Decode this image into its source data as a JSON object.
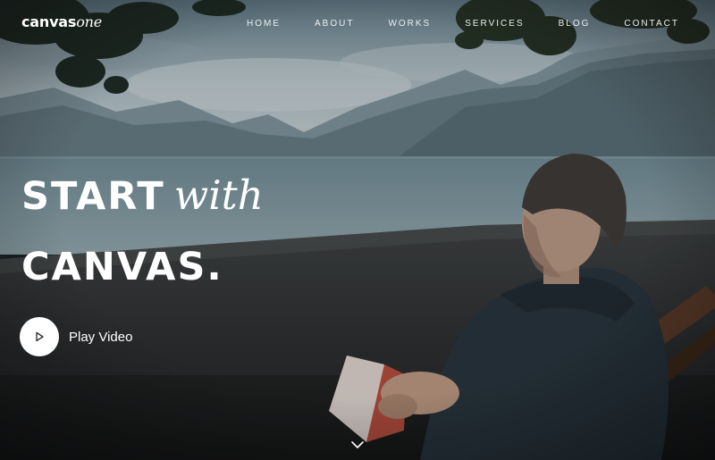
{
  "logo": {
    "strong": "canvas",
    "light": "one"
  },
  "nav": {
    "items": [
      {
        "label": "HOME"
      },
      {
        "label": "ABOUT"
      },
      {
        "label": "WORKS"
      },
      {
        "label": "SERVICES"
      },
      {
        "label": "BLOG"
      },
      {
        "label": "CONTACT"
      }
    ]
  },
  "hero": {
    "headline_word1": "START",
    "headline_word2": "with",
    "headline_word3": "CANVAS.",
    "play_label": "Play Video"
  },
  "icons": {
    "play": "play-icon",
    "scroll": "chevron-down-icon"
  },
  "colors": {
    "text": "#ffffff",
    "play_button_bg": "#ffffff",
    "play_icon": "#333333"
  }
}
